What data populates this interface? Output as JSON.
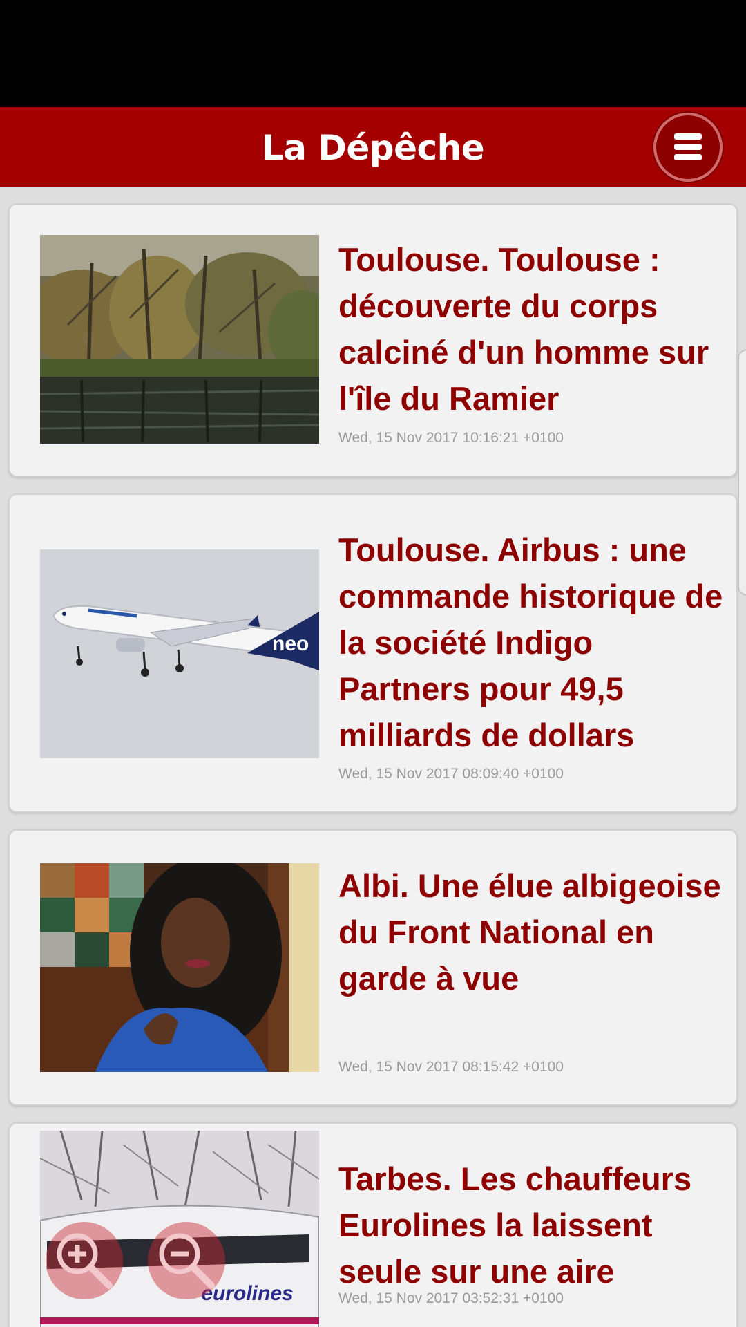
{
  "header": {
    "title": "La Dépêche",
    "menu_icon": "hamburger-menu-icon"
  },
  "colors": {
    "brand": "#a50000",
    "headline": "#8e0000",
    "date": "#9a9a9a",
    "card": "#f2f2f2"
  },
  "articles": [
    {
      "headline": "Toulouse. Toulouse : découverte du corps calciné d'un homme sur l'île du Ramier",
      "date": "Wed, 15 Nov 2017 10:16:21 +0100",
      "image": "river-trees-photo"
    },
    {
      "headline": "Toulouse. Airbus : une commande historique de la société Indigo Partners pour 49,5 milliards de dollars",
      "date": "Wed, 15 Nov 2017 08:09:40 +0100",
      "image": "airbus-plane-photo",
      "image_text": "neo"
    },
    {
      "headline": "Albi. Une élue albigeoise du Front National en garde à vue",
      "date": "Wed, 15 Nov 2017 08:15:42 +0100",
      "image": "woman-portrait-photo"
    },
    {
      "headline": "Tarbes. Les chauffeurs Eurolines la laissent seule sur une aire",
      "date": "Wed, 15 Nov 2017 03:52:31 +0100",
      "image": "eurolines-bus-photo",
      "image_text": "eurolines"
    }
  ],
  "zoom": {
    "zoom_in_icon": "zoom-in-icon",
    "zoom_out_icon": "zoom-out-icon"
  }
}
